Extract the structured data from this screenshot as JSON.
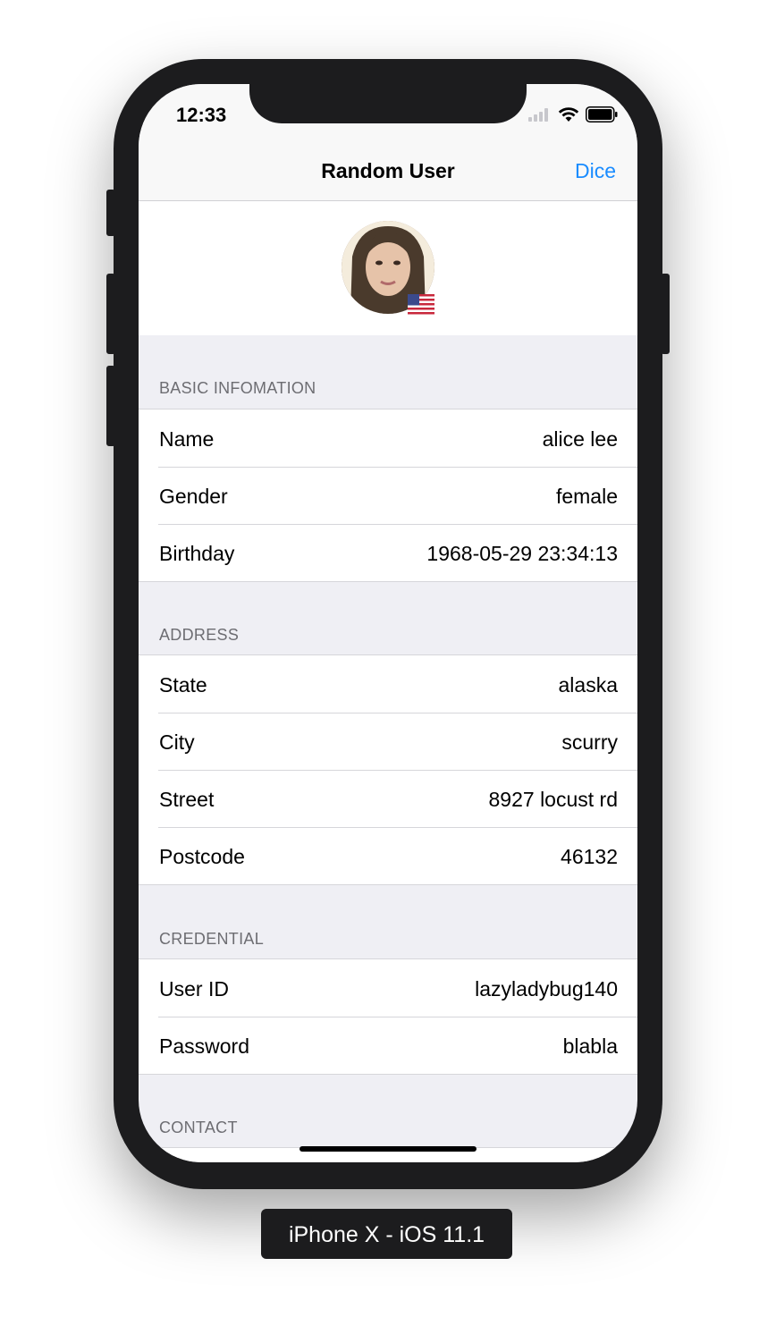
{
  "status_bar": {
    "time": "12:33",
    "icons": [
      "cellular-signal-icon",
      "wifi-icon",
      "battery-icon"
    ]
  },
  "nav": {
    "title": "Random User",
    "action_label": "Dice"
  },
  "profile": {
    "avatar": "avatar-photo",
    "flag": "us-flag-icon"
  },
  "sections": {
    "basic": {
      "header": "BASIC INFOMATION",
      "rows": [
        {
          "label": "Name",
          "value": "alice lee"
        },
        {
          "label": "Gender",
          "value": "female"
        },
        {
          "label": "Birthday",
          "value": "1968-05-29 23:34:13"
        }
      ]
    },
    "address": {
      "header": "ADDRESS",
      "rows": [
        {
          "label": "State",
          "value": "alaska"
        },
        {
          "label": "City",
          "value": "scurry"
        },
        {
          "label": "Street",
          "value": "8927 locust rd"
        },
        {
          "label": "Postcode",
          "value": "46132"
        }
      ]
    },
    "credential": {
      "header": "CREDENTIAL",
      "rows": [
        {
          "label": "User ID",
          "value": "lazyladybug140"
        },
        {
          "label": "Password",
          "value": "blabla"
        }
      ]
    },
    "contact": {
      "header": "CONTACT"
    }
  },
  "device_label": "iPhone X - iOS 11.1",
  "colors": {
    "accent": "#1a8cff",
    "grouped_background": "#efeff4",
    "device_frame": "#1c1c1e"
  }
}
